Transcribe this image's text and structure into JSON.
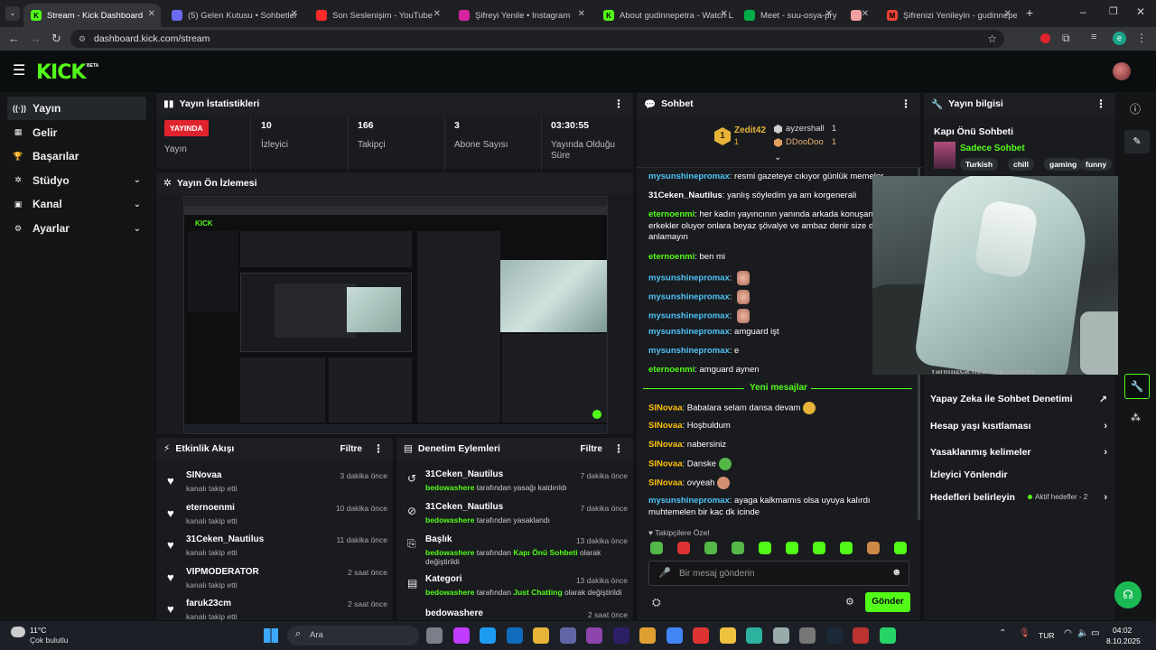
{
  "browser": {
    "tabs": [
      {
        "title": "Stream - Kick Dashboard",
        "active": true,
        "fav_color": "#53fc18",
        "fav_letter": "K"
      },
      {
        "title": "(5) Gelen Kutusu • Sohbetler",
        "active": false,
        "fav_color": "#6b6bf0",
        "fav_letter": ""
      },
      {
        "title": "Son Seslenişim - YouTube",
        "active": false,
        "fav_color": "#ff2a2a",
        "fav_letter": ""
      },
      {
        "title": "Şifreyi Yenile • Instagram",
        "active": false,
        "fav_color": "#d6249f",
        "fav_letter": ""
      },
      {
        "title": "About gudinnepetra - Watch Li",
        "active": false,
        "fav_color": "#53fc18",
        "fav_letter": "K"
      },
      {
        "title": "Meet - suu-osya-pry",
        "active": false,
        "fav_color": "#00ac47",
        "fav_letter": ""
      },
      {
        "title": "",
        "active": false,
        "fav_color": "#f0a0a0",
        "fav_letter": ""
      },
      {
        "title": "Şifrenizi Yenileyin - gudinnepet",
        "active": false,
        "fav_color": "#ea4335",
        "fav_letter": "M"
      }
    ],
    "url": "dashboard.kick.com/stream",
    "profile_letter": "e"
  },
  "brand": {
    "logo": "KICK",
    "beta": "BETA",
    "accent": "#53fc18"
  },
  "sidebar": {
    "items": [
      {
        "label": "Yayın",
        "icon": "broadcast-icon",
        "glyph": "((·))",
        "active": true,
        "expand": false
      },
      {
        "label": "Gelir",
        "icon": "revenue-icon",
        "glyph": "▦",
        "active": false,
        "expand": false
      },
      {
        "label": "Başarılar",
        "icon": "trophy-icon",
        "glyph": "🏆",
        "active": false,
        "expand": false
      },
      {
        "label": "Stüdyo",
        "icon": "studio-icon",
        "glyph": "✲",
        "active": false,
        "expand": true
      },
      {
        "label": "Kanal",
        "icon": "channel-icon",
        "glyph": "▣",
        "active": false,
        "expand": true
      },
      {
        "label": "Ayarlar",
        "icon": "settings-icon",
        "glyph": "⚙",
        "active": false,
        "expand": true
      }
    ]
  },
  "stats": {
    "title": "Yayın İstatistikleri",
    "live_badge": "YAYINDA",
    "live_label": "Yayın",
    "items": [
      {
        "value": "10",
        "label": "İzleyici"
      },
      {
        "value": "166",
        "label": "Takipçi"
      },
      {
        "value": "3",
        "label": "Abone Sayısı"
      },
      {
        "value": "03:30:55",
        "label": "Yayında Olduğu Süre"
      }
    ]
  },
  "preview": {
    "title": "Yayın Ön İzlemesi"
  },
  "activity": {
    "title": "Etkinlik Akışı",
    "filter": "Filtre",
    "rows": [
      {
        "name": "SINovaa",
        "sub": "kanalı takip etti",
        "time": "3 dakika önce"
      },
      {
        "name": "eternoenmi",
        "sub": "kanalı takip etti",
        "time": "10 dakika önce"
      },
      {
        "name": "31Ceken_Nautilus",
        "sub": "kanalı takip etti",
        "time": "11 dakika önce"
      },
      {
        "name": "VIPMODERATOR",
        "sub": "kanalı takip etti",
        "time": "2 saat önce"
      },
      {
        "name": "faruk23cm",
        "sub": "kanalı takip etti",
        "time": "2 saat önce"
      }
    ]
  },
  "moderation": {
    "title": "Denetim Eylemleri",
    "filter": "Filtre",
    "rows": [
      {
        "icon": "↺",
        "icon_name": "undo-icon",
        "name": "31Ceken_Nautilus",
        "actor": "bedowashere",
        "text": "tarafından yasağı kaldırıldı",
        "extra": "",
        "tail": "",
        "time": "7 dakika önce"
      },
      {
        "icon": "⊘",
        "icon_name": "ban-icon",
        "name": "31Ceken_Nautilus",
        "actor": "bedowashere",
        "text": "tarafından yasaklandı",
        "extra": "",
        "tail": "",
        "time": "7 dakika önce"
      },
      {
        "icon": "⎘",
        "icon_name": "title-icon",
        "name": "Başlık",
        "actor": "bedowashere",
        "text": "tarafından",
        "extra": "Kapı Önü Sohbeti",
        "tail": "olarak değiştirildi",
        "time": "13 dakika önce"
      },
      {
        "icon": "▤",
        "icon_name": "category-icon",
        "name": "Kategori",
        "actor": "bedowashere",
        "text": "tarafından",
        "extra": "Just Chatting",
        "tail": "olarak değiştirildi",
        "time": "13 dakika önce"
      },
      {
        "icon": "",
        "icon_name": "title-icon",
        "name": "bedowashere",
        "actor": "",
        "text": "",
        "extra": "",
        "tail": "",
        "time": "2 saat önce"
      }
    ]
  },
  "chat": {
    "title": "Sohbet",
    "top": [
      {
        "rank": "1",
        "name": "Zedit42",
        "count": "1"
      },
      {
        "rank": "",
        "name": "ayzershall",
        "count": "1"
      },
      {
        "rank": "",
        "name": "DDooDoo",
        "count": "1"
      }
    ],
    "messages": [
      {
        "user": "mysunshinepromax",
        "color": "#4fc3f7",
        "text": "resmi gazeteye cıkıyor günlük memeler"
      },
      {
        "user": "31Ceken_Nautilus",
        "color": "#ffffff",
        "text": "yanlış söyledim ya am korgenerali"
      },
      {
        "user": "eternoenmi",
        "color": "#53fc18",
        "text": "her kadın yayıncının yanında arkada konuşan np erkekler oluyor onlara beyaz şövalye ve ambaz denir size de yanlış anlamayın"
      },
      {
        "user": "eternoenmi",
        "color": "#53fc18",
        "text": "ben mi"
      },
      {
        "user": "mysunshinepromax",
        "color": "#4fc3f7",
        "text": ""
      },
      {
        "user": "mysunshinepromax",
        "color": "#4fc3f7",
        "text": ""
      },
      {
        "user": "mysunshinepromax",
        "color": "#4fc3f7",
        "text": ""
      },
      {
        "user": "mysunshinepromax",
        "color": "#4fc3f7",
        "text": "amguard işt"
      },
      {
        "user": "mysunshinepromax",
        "color": "#4fc3f7",
        "text": "e"
      },
      {
        "user": "eternoenmi",
        "color": "#53fc18",
        "text": "amguard aynen"
      }
    ],
    "new_label": "Yeni mesajlar",
    "new_messages": [
      {
        "user": "SINovaa",
        "color": "#ffc107",
        "text": "Babalara selam dansa devam"
      },
      {
        "user": "SINovaa",
        "color": "#ffc107",
        "text": "Hoşbuldum"
      },
      {
        "user": "SINovaa",
        "color": "#ffc107",
        "text": "nabersiniz"
      },
      {
        "user": "SINovaa",
        "color": "#ffc107",
        "text": "Danske"
      },
      {
        "user": "SINovaa",
        "color": "#ffc107",
        "text": "ovyeah"
      },
      {
        "user": "mysunshinepromax",
        "color": "#4fc3f7",
        "text": "ayaga kalkmamıs olsa uyuya kalırdı muhtemelen bir kac dk icinde"
      }
    ],
    "followers_only": "Takipçilere Özel",
    "input_placeholder": "Bir mesaj gönderin",
    "send": "Gönder"
  },
  "info": {
    "title": "Yayın bilgisi",
    "stream_title": "Kapı Önü Sohbeti",
    "category": "Sadece Sohbet",
    "tags": [
      "Turkish",
      "chill",
      "gaming",
      "funny"
    ],
    "partial_row": "Yanıtlızca nedenle sohbet",
    "rows": [
      {
        "label": "Yapay Zeka ile Sohbet Denetimi",
        "icon": "↗",
        "extra": ""
      },
      {
        "label": "Hesap yaşı kısıtlaması",
        "icon": "›",
        "extra": ""
      },
      {
        "label": "Yasaklanmış kelimeler",
        "icon": "›",
        "extra": ""
      },
      {
        "label": "İzleyici Yönlendir",
        "icon": "",
        "extra": ""
      },
      {
        "label": "Hedefleri belirleyin",
        "icon": "›",
        "extra": "Aktif hedefler - 2"
      }
    ]
  },
  "taskbar": {
    "weather_temp": "11°C",
    "weather_desc": "Çok bulutlu",
    "search": "Ara",
    "lang": "TUR",
    "time": "04:02",
    "date": "8.10.2025"
  }
}
